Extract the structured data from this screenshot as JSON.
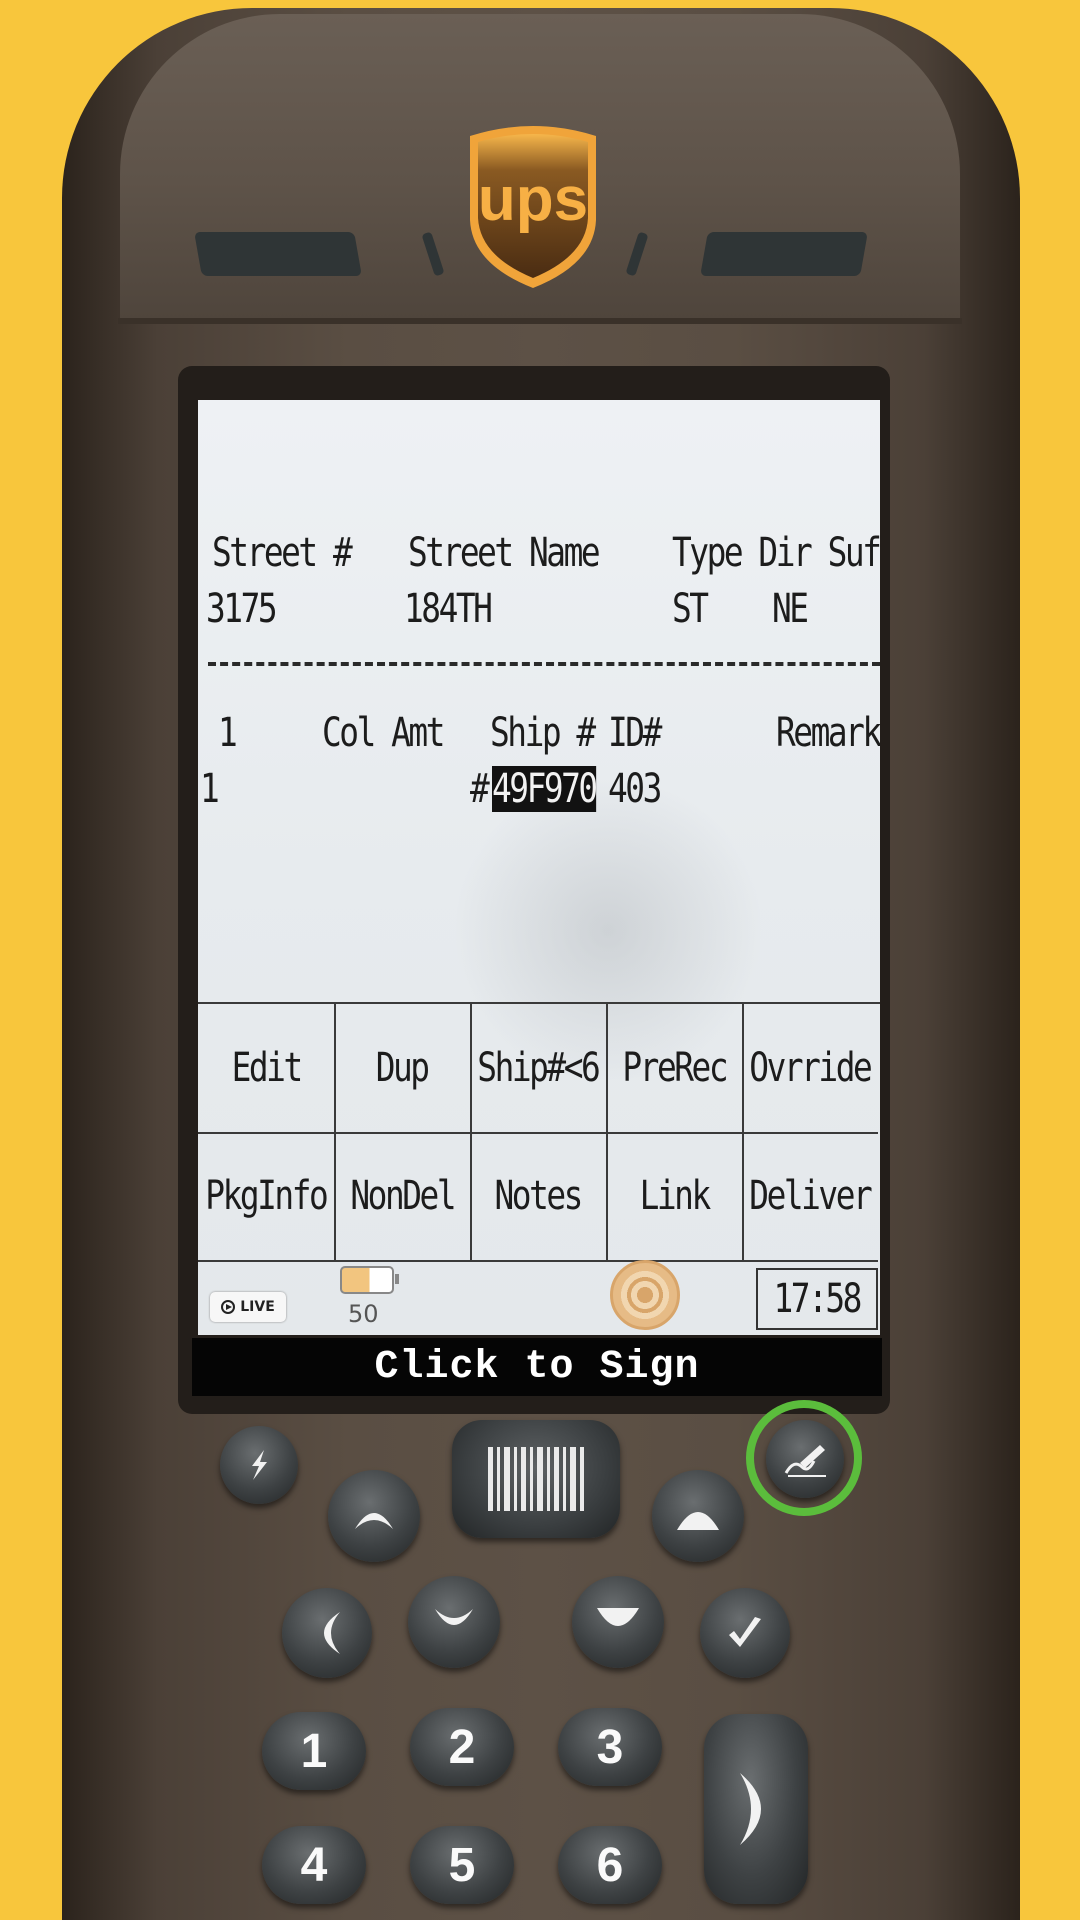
{
  "header": {
    "logo_text": "ups",
    "brand_color": "#6b4a1f",
    "logo_accent": "#f4a623"
  },
  "screen": {
    "address_headers": {
      "street_no": "Street #",
      "street_name": "Street Name",
      "type_dir_suf": "Type Dir Suf"
    },
    "address_values": {
      "street_no": "3175",
      "street_name": "184TH",
      "type": "ST",
      "dir": "NE"
    },
    "package_headers": {
      "index": "1",
      "col_amt": "Col Amt",
      "ship_no": "Ship #",
      "id_no": "ID#",
      "remark": "Remark"
    },
    "package_values": {
      "index": "1",
      "ship_prefix": "#",
      "ship_no": "49F970",
      "id_no": "403"
    },
    "menu_row_1": [
      "Edit",
      "Dup",
      "Ship#<6",
      "PreRec",
      "Ovrride"
    ],
    "menu_row_2": [
      "PkgInfo",
      "NonDel",
      "Notes",
      "Link",
      "Deliver"
    ],
    "status": {
      "live_label": "LIVE",
      "battery_percent": "50",
      "battery_level": 0.5,
      "clock": "17:58"
    }
  },
  "sign_banner": "Click to Sign",
  "keypad": {
    "numbers": [
      "1",
      "2",
      "3",
      "4",
      "5",
      "6"
    ]
  },
  "colors": {
    "background": "#f8c63c",
    "highlight_ring": "#5bbd3c"
  }
}
